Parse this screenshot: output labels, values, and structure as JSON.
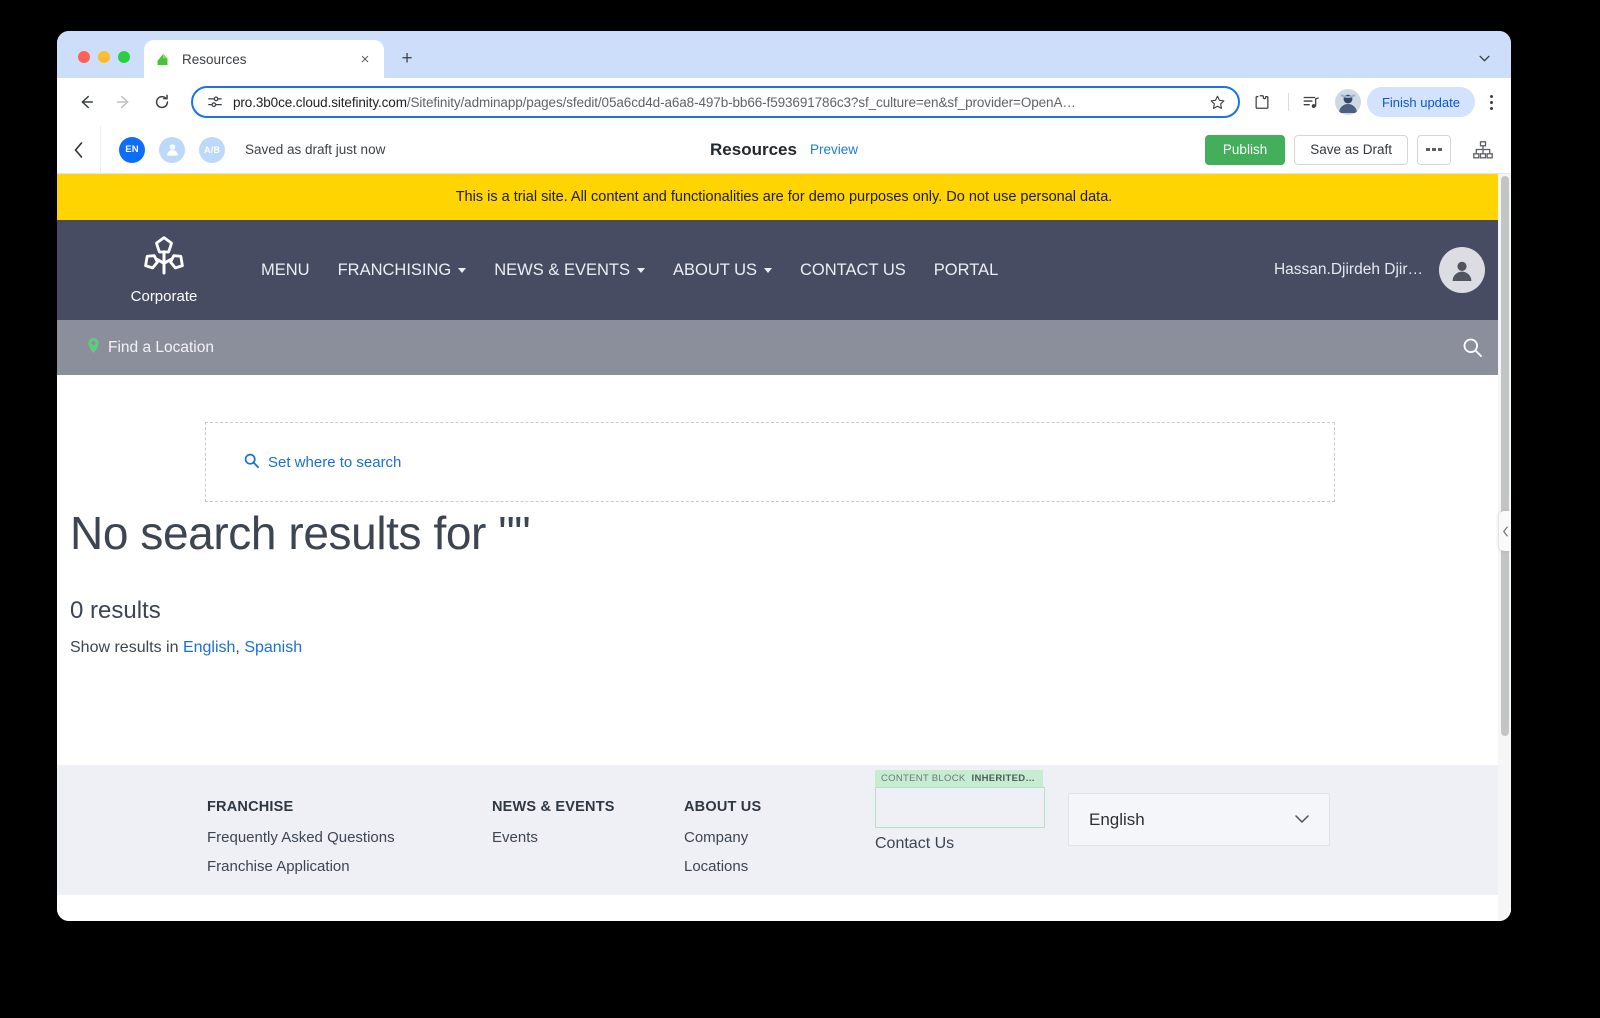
{
  "browser": {
    "tab": {
      "title": "Resources",
      "favicon": "sitefinity-logo-icon",
      "close_label": "×"
    },
    "new_tab_label": "+",
    "tabstrip_chevron": "⌄",
    "nav": {
      "back": "←",
      "forward": "→",
      "reload": "↻"
    },
    "omnibox": {
      "url_main": "pro.3b0ce.cloud.sitefinity.com",
      "url_path": "/Sitefinity/adminapp/pages/sfedit/05a6cd4d-a6a8-497b-bb66-f593691786c3?sf_culture=en&sf_provider=OpenA…",
      "full_url": "pro.3b0ce.cloud.sitefinity.com/Sitefinity/adminapp/pages/sfedit/05a6cd4d-a6a8-497b-bb66-f593691786c3?sf_culture=en&sf_provider=OpenA…",
      "site_info_icon": "tune-icon",
      "bookmark_icon": "star-outline-icon"
    },
    "toolbar_icons": [
      "extensions-puzzle-icon",
      "reading-list-icon"
    ],
    "profile_avatar": "user-avatar",
    "finish_update_label": "Finish update",
    "menu_icon": "kebab-menu-icon"
  },
  "sitefinity_bar": {
    "back_icon": "chevron-left-icon",
    "language_badge": "EN",
    "persona_icon": "person-icon",
    "ab_badge": "A/B",
    "status_text": "Saved as draft just now",
    "page_title": "Resources",
    "preview_label": "Preview",
    "publish_label": "Publish",
    "save_draft_label": "Save as Draft",
    "more_icon": "ellipsis-icon",
    "sitemap_icon": "sitemap-icon"
  },
  "trial_banner": {
    "text": "This is a trial site. All content and functionalities are for demo purposes only. Do not use personal data.",
    "background": "#ffd400"
  },
  "site_header": {
    "logo_icon": "corporate-trident-logo-icon",
    "brand_name": "Corporate",
    "background": "#474c63",
    "nav_items": [
      {
        "label": "MENU",
        "has_caret": false
      },
      {
        "label": "FRANCHISING",
        "has_caret": true
      },
      {
        "label": "NEWS & EVENTS",
        "has_caret": true
      },
      {
        "label": "ABOUT US",
        "has_caret": true
      },
      {
        "label": "CONTACT US",
        "has_caret": false
      },
      {
        "label": "PORTAL",
        "has_caret": false
      }
    ],
    "username": "Hassan.Djirdeh Djir…",
    "avatar_icon": "person-avatar-icon"
  },
  "location_bar": {
    "pin_icon": "map-pin-icon",
    "label": "Find a Location",
    "search_icon": "search-icon",
    "background": "#8b8f9b"
  },
  "main": {
    "search_scope": {
      "icon": "search-icon",
      "link_label": "Set where to search"
    },
    "results_title": "No search results for \"\"",
    "results_count": "0 results",
    "show_results_prefix": "Show results in ",
    "languages": [
      {
        "label": "English"
      },
      {
        "label": "Spanish"
      }
    ],
    "language_separator": ", "
  },
  "footer": {
    "columns": [
      {
        "heading": "FRANCHISE",
        "links": [
          "Frequently Asked Questions",
          "Franchise Application"
        ]
      },
      {
        "heading": "NEWS & EVENTS",
        "links": [
          "Events",
          ""
        ]
      },
      {
        "heading": "ABOUT US",
        "links": [
          "Company",
          "Locations"
        ]
      }
    ],
    "content_block": {
      "label": "CONTENT BLOCK",
      "status": "INHERITED…",
      "strip_background": "#c6ecd1"
    },
    "contact_us_label": "Contact Us",
    "language_select": {
      "value": "English",
      "caret": "⌄"
    }
  },
  "colors": {
    "publish_green": "#43af5b",
    "link_blue": "#1b6fd6",
    "header_navy": "#474c63",
    "banner_yellow": "#ffd400"
  }
}
